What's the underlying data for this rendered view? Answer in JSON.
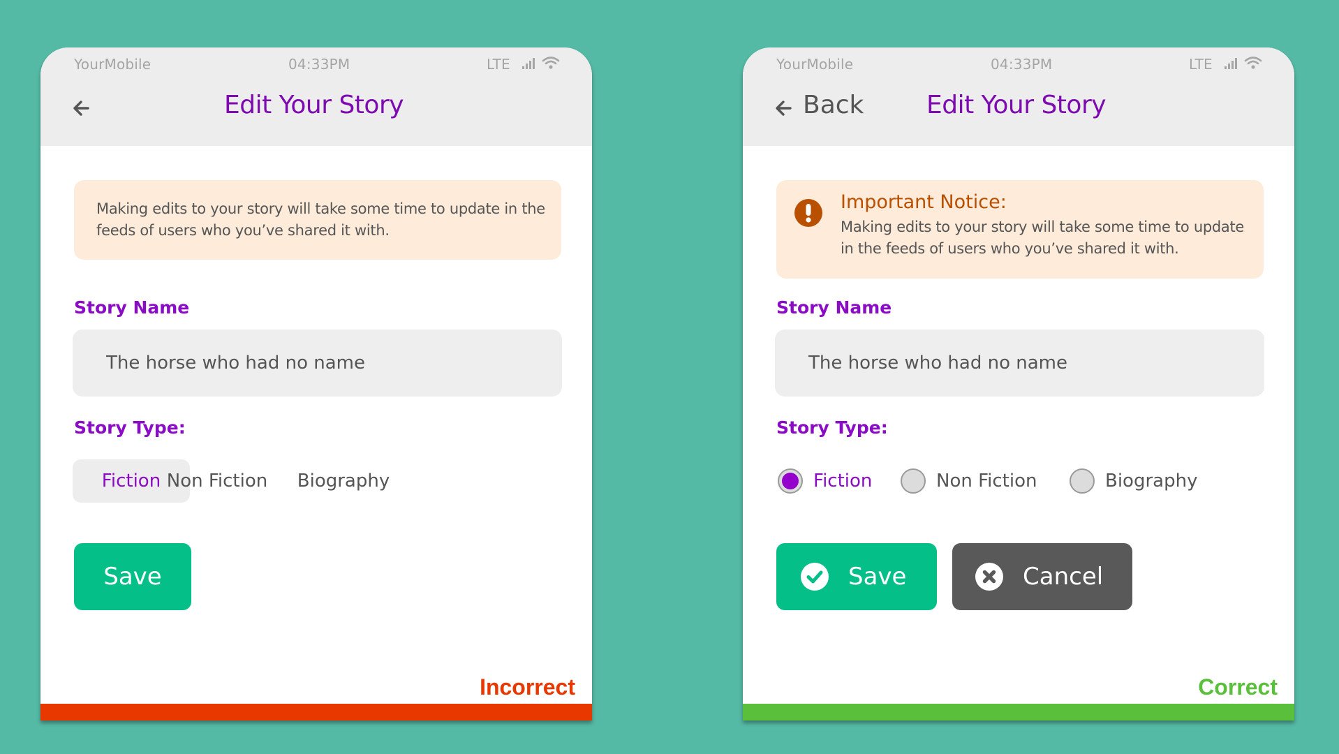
{
  "colors": {
    "background": "#55baa5",
    "brand_purple": "#8a0cc4",
    "primary_green": "#04c088",
    "cancel_gray": "#595959",
    "notice_bg": "#feebd9",
    "notice_accent": "#b85000",
    "incorrect": "#e83800",
    "correct": "#5abf3a"
  },
  "left": {
    "status": {
      "carrier": "YourMobile",
      "time": "04:33PM",
      "network": "LTE"
    },
    "header": {
      "title": "Edit Your Story",
      "back_icon": "arrow-left-icon"
    },
    "notice": {
      "text": "Making edits to your story will take some time to update in the feeds of users who you’ve shared it with."
    },
    "story_name": {
      "label": "Story Name",
      "value": "The horse who had no name"
    },
    "story_type": {
      "label": "Story Type:",
      "options": [
        {
          "label": "Fiction",
          "selected": true
        },
        {
          "label": "Non Fiction",
          "selected": false
        },
        {
          "label": "Biography",
          "selected": false
        }
      ]
    },
    "buttons": {
      "save": "Save"
    },
    "verdict": "Incorrect"
  },
  "right": {
    "status": {
      "carrier": "YourMobile",
      "time": "04:33PM",
      "network": "LTE"
    },
    "header": {
      "title": "Edit Your Story",
      "back_label": "Back",
      "back_icon": "arrow-left-icon"
    },
    "notice": {
      "icon": "exclamation-circle-icon",
      "title": "Important Notice:",
      "text": "Making edits to your story will take some time to update in the feeds of users who you’ve shared it with."
    },
    "story_name": {
      "label": "Story Name",
      "value": "The horse who had no name"
    },
    "story_type": {
      "label": "Story Type:",
      "options": [
        {
          "label": "Fiction",
          "selected": true
        },
        {
          "label": "Non Fiction",
          "selected": false
        },
        {
          "label": "Biography",
          "selected": false
        }
      ]
    },
    "buttons": {
      "save": "Save",
      "save_icon": "check-circle-icon",
      "cancel": "Cancel",
      "cancel_icon": "x-circle-icon"
    },
    "verdict": "Correct"
  }
}
